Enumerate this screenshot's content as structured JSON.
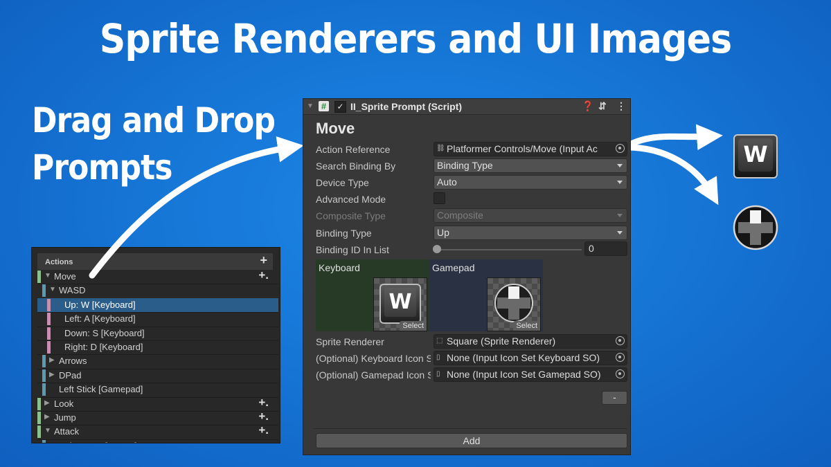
{
  "headline": "Sprite Renderers and UI Images",
  "subhead": [
    "Drag and Drop",
    "Prompts"
  ],
  "actions_panel": {
    "title": "Actions",
    "rows": [
      {
        "label": "Move",
        "color": "#8dc08d",
        "indent": 0,
        "expanded": true,
        "plus": true
      },
      {
        "label": "WASD",
        "color": "#5a9ab5",
        "indent": 1,
        "expanded": true,
        "plus": false
      },
      {
        "label": "Up: W [Keyboard]",
        "color": "#c98fb0",
        "indent": 2,
        "expanded": null,
        "plus": false,
        "selected": true
      },
      {
        "label": "Left: A [Keyboard]",
        "color": "#c98fb0",
        "indent": 2,
        "expanded": null,
        "plus": false
      },
      {
        "label": "Down: S [Keyboard]",
        "color": "#c98fb0",
        "indent": 2,
        "expanded": null,
        "plus": false
      },
      {
        "label": "Right: D [Keyboard]",
        "color": "#c98fb0",
        "indent": 2,
        "expanded": null,
        "plus": false
      },
      {
        "label": "Arrows",
        "color": "#5a9ab5",
        "indent": 1,
        "expanded": false,
        "plus": false
      },
      {
        "label": "DPad",
        "color": "#5a9ab5",
        "indent": 1,
        "expanded": false,
        "plus": false
      },
      {
        "label": "Left Stick [Gamepad]",
        "color": "#5a9ab5",
        "indent": 1,
        "expanded": null,
        "plus": false
      },
      {
        "label": "Look",
        "color": "#8dc08d",
        "indent": 0,
        "expanded": false,
        "plus": true
      },
      {
        "label": "Jump",
        "color": "#8dc08d",
        "indent": 0,
        "expanded": false,
        "plus": true
      },
      {
        "label": "Attack",
        "color": "#8dc08d",
        "indent": 0,
        "expanded": true,
        "plus": true
      },
      {
        "label": "Left Button [Mouse]",
        "color": "#5a9ab5",
        "indent": 1,
        "expanded": null,
        "plus": false
      }
    ]
  },
  "inspector": {
    "component_title": "II_Sprite Prompt (Script)",
    "section_title": "Move",
    "props": {
      "action_reference": {
        "label": "Action Reference",
        "value": "Platformer Controls/Move (Input Ac"
      },
      "search_binding_by": {
        "label": "Search Binding By",
        "value": "Binding Type"
      },
      "device_type": {
        "label": "Device Type",
        "value": "Auto"
      },
      "advanced_mode": {
        "label": "Advanced Mode",
        "checked": false
      },
      "composite_type": {
        "label": "Composite Type",
        "value": "Composite"
      },
      "binding_type": {
        "label": "Binding Type",
        "value": "Up"
      },
      "binding_id": {
        "label": "Binding ID In List",
        "value": "0"
      },
      "sprite_renderer": {
        "label": "Sprite Renderer",
        "value": "Square (Sprite Renderer)"
      },
      "keyboard_icons": {
        "label": "(Optional) Keyboard Icon Set",
        "value": "None (Input Icon Set Keyboard SO)"
      },
      "gamepad_icons": {
        "label": "(Optional) Gamepad Icon Set",
        "value": "None (Input Icon Set Gamepad SO)"
      }
    },
    "preview": {
      "keyboard_label": "Keyboard",
      "gamepad_label": "Gamepad",
      "select_label": "Select",
      "keyboard_key": "W"
    },
    "minus_label": "-",
    "add_label": "Add"
  },
  "results": {
    "keyboard_key": "W"
  }
}
